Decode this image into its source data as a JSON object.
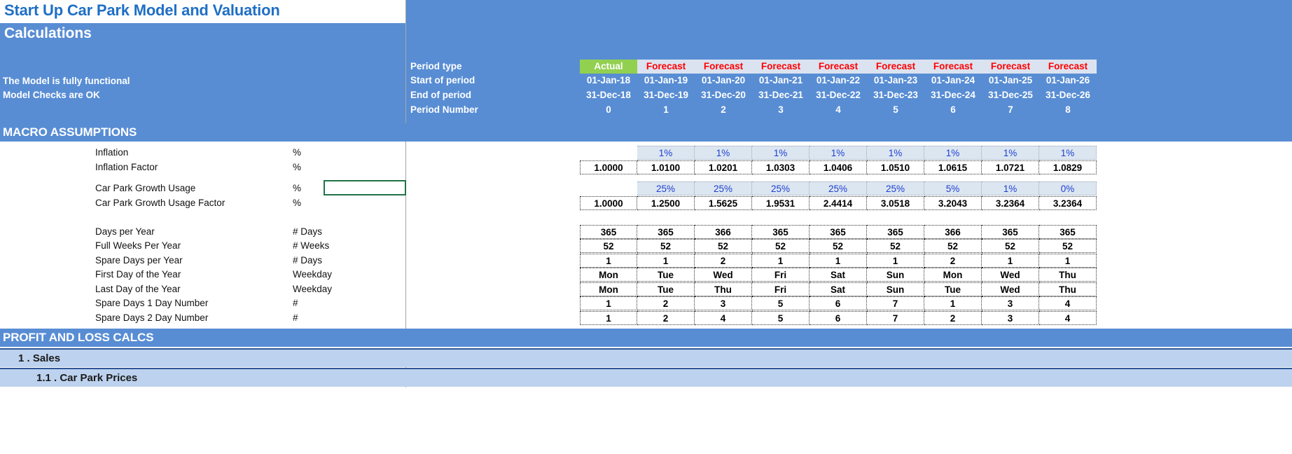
{
  "titles": {
    "main": "Start Up Car Park Model and Valuation",
    "sub": "Calculations",
    "note1": "The Model is fully functional",
    "note2": "Model Checks are OK"
  },
  "header": {
    "labels": {
      "period_type": "Period type",
      "start_of_period": "Start of period",
      "end_of_period": "End of period",
      "period_number": "Period Number"
    },
    "period_type": [
      "Actual",
      "Forecast",
      "Forecast",
      "Forecast",
      "Forecast",
      "Forecast",
      "Forecast",
      "Forecast",
      "Forecast"
    ],
    "start_of_period": [
      "01-Jan-18",
      "01-Jan-19",
      "01-Jan-20",
      "01-Jan-21",
      "01-Jan-22",
      "01-Jan-23",
      "01-Jan-24",
      "01-Jan-25",
      "01-Jan-26"
    ],
    "end_of_period": [
      "31-Dec-18",
      "31-Dec-19",
      "31-Dec-20",
      "31-Dec-21",
      "31-Dec-22",
      "31-Dec-23",
      "31-Dec-24",
      "31-Dec-25",
      "31-Dec-26"
    ],
    "period_number": [
      "0",
      "1",
      "2",
      "3",
      "4",
      "5",
      "6",
      "7",
      "8"
    ]
  },
  "sections": {
    "macro": "MACRO ASSUMPTIONS",
    "pl": "PROFIT AND LOSS CALCS",
    "sales": "1 . Sales",
    "car_park_prices": "1.1 . Car Park Prices"
  },
  "rows": [
    {
      "label": "Inflation",
      "unit": "%",
      "style": "input",
      "first_blank": true,
      "values": [
        "",
        "1%",
        "1%",
        "1%",
        "1%",
        "1%",
        "1%",
        "1%",
        "1%"
      ]
    },
    {
      "label": "Inflation Factor",
      "unit": "%",
      "style": "calc",
      "first_blank": false,
      "values": [
        "1.0000",
        "1.0100",
        "1.0201",
        "1.0303",
        "1.0406",
        "1.0510",
        "1.0615",
        "1.0721",
        "1.0829"
      ]
    },
    {
      "label": "Car Park Growth Usage",
      "unit": "%",
      "style": "input",
      "first_blank": true,
      "values": [
        "",
        "25%",
        "25%",
        "25%",
        "25%",
        "25%",
        "5%",
        "1%",
        "0%"
      ]
    },
    {
      "label": "Car Park Growth Usage Factor",
      "unit": "%",
      "style": "calc",
      "first_blank": false,
      "values": [
        "1.0000",
        "1.2500",
        "1.5625",
        "1.9531",
        "2.4414",
        "3.0518",
        "3.2043",
        "3.2364",
        "3.2364"
      ]
    },
    {
      "label": "Days per Year",
      "unit": "# Days",
      "style": "calc",
      "first_blank": false,
      "values": [
        "365",
        "365",
        "366",
        "365",
        "365",
        "365",
        "366",
        "365",
        "365"
      ]
    },
    {
      "label": "Full Weeks Per Year",
      "unit": "# Weeks",
      "style": "calc",
      "first_blank": false,
      "values": [
        "52",
        "52",
        "52",
        "52",
        "52",
        "52",
        "52",
        "52",
        "52"
      ]
    },
    {
      "label": "Spare Days per Year",
      "unit": "# Days",
      "style": "calc",
      "first_blank": false,
      "values": [
        "1",
        "1",
        "2",
        "1",
        "1",
        "1",
        "2",
        "1",
        "1"
      ]
    },
    {
      "label": "First Day of the Year",
      "unit": "Weekday",
      "style": "calc",
      "first_blank": false,
      "values": [
        "Mon",
        "Tue",
        "Wed",
        "Fri",
        "Sat",
        "Sun",
        "Mon",
        "Wed",
        "Thu"
      ]
    },
    {
      "label": "Last Day of the Year",
      "unit": "Weekday",
      "style": "calc",
      "first_blank": false,
      "values": [
        "Mon",
        "Tue",
        "Thu",
        "Fri",
        "Sat",
        "Sun",
        "Tue",
        "Wed",
        "Thu"
      ]
    },
    {
      "label": "Spare Days 1 Day Number",
      "unit": "#",
      "style": "calc",
      "first_blank": false,
      "values": [
        "1",
        "2",
        "3",
        "5",
        "6",
        "7",
        "1",
        "3",
        "4"
      ]
    },
    {
      "label": "Spare Days 2 Day Number",
      "unit": "#",
      "style": "calc",
      "first_blank": false,
      "values": [
        "1",
        "2",
        "4",
        "5",
        "6",
        "7",
        "2",
        "3",
        "4"
      ]
    }
  ],
  "colors": {
    "header_blue": "#588DD4",
    "title_blue": "#1F6FC4",
    "actual_green": "#92D050",
    "forecast_red": "#FF0000",
    "input_blue_text": "#1F3FCF",
    "input_fill": "#DCE6F1",
    "subsection_fill": "#BDD2EE",
    "active_cell_border": "#217346"
  }
}
